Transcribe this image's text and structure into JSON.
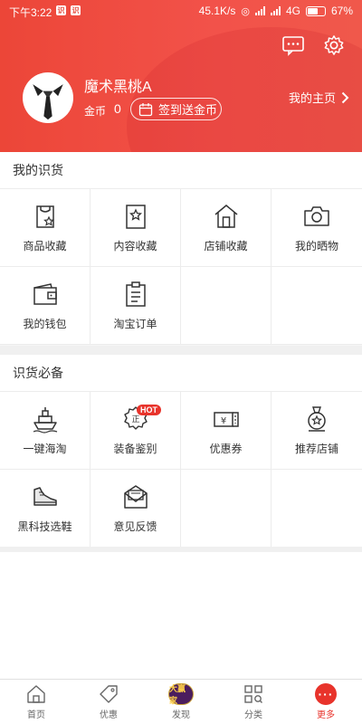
{
  "status_bar": {
    "time": "下午3:22",
    "app_badges": [
      "识",
      "识"
    ],
    "net_speed": "45.1K/s",
    "network": "4G",
    "battery": "67%",
    "battery_level": 0.67
  },
  "header": {
    "username": "魔术黑桃A",
    "coin_label": "金币",
    "coin_value": "0",
    "checkin_label": "签到送金币",
    "homepage_label": "我的主页",
    "icons": [
      "message-icon",
      "settings-icon"
    ]
  },
  "my_section": {
    "title": "我的识货",
    "items": [
      {
        "label": "商品收藏",
        "icon": "bag-star-icon"
      },
      {
        "label": "内容收藏",
        "icon": "bookmark-star-icon"
      },
      {
        "label": "店铺收藏",
        "icon": "store-icon"
      },
      {
        "label": "我的晒物",
        "icon": "camera-icon"
      },
      {
        "label": "我的钱包",
        "icon": "wallet-icon"
      },
      {
        "label": "淘宝订单",
        "icon": "clipboard-icon"
      }
    ]
  },
  "essentials_section": {
    "title": "识货必备",
    "items": [
      {
        "label": "一键海淘",
        "icon": "ship-icon"
      },
      {
        "label": "装备鉴别",
        "icon": "authenticity-badge-icon",
        "badge": "HOT"
      },
      {
        "label": "优惠券",
        "icon": "coupon-icon"
      },
      {
        "label": "推荐店铺",
        "icon": "medal-icon"
      },
      {
        "label": "黑科技选鞋",
        "icon": "sneaker-icon"
      },
      {
        "label": "意见反馈",
        "icon": "mail-icon"
      }
    ]
  },
  "tabbar": {
    "items": [
      {
        "label": "首页",
        "icon": "home-icon",
        "active": false
      },
      {
        "label": "优惠",
        "icon": "tag-icon",
        "active": false
      },
      {
        "label": "发现",
        "icon": "discover-badge-icon",
        "active": false,
        "badge_text": "大赢家"
      },
      {
        "label": "分类",
        "icon": "category-grid-icon",
        "active": false
      },
      {
        "label": "更多",
        "icon": "more-dots-icon",
        "active": true
      }
    ]
  },
  "colors": {
    "brand_red": "#e8332b",
    "header_gradient_start": "#ec4638",
    "header_gradient_end": "#f0584b"
  }
}
